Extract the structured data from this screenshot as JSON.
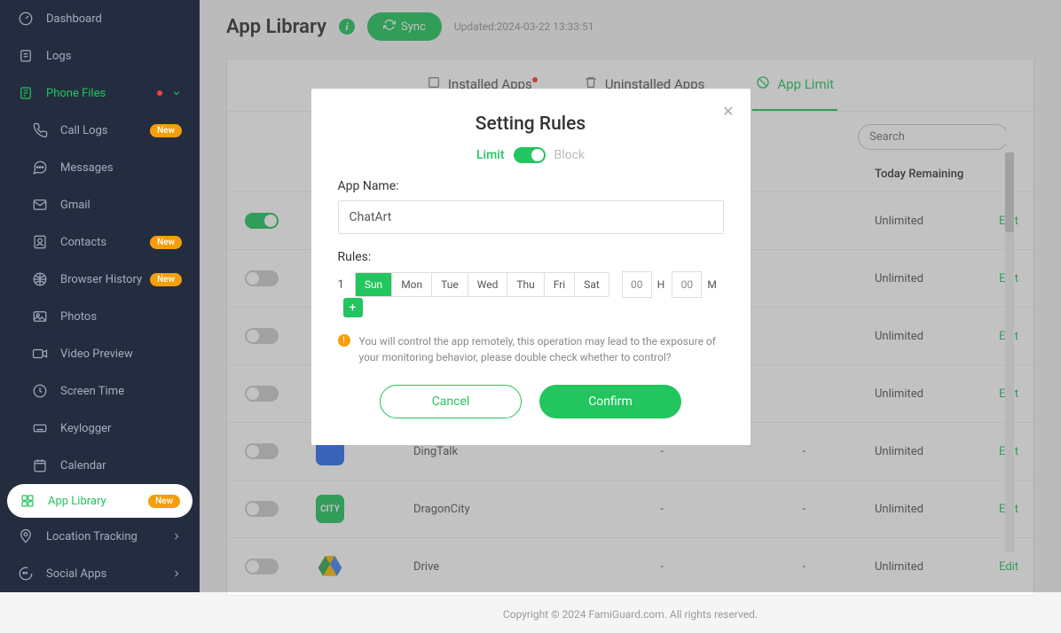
{
  "sidebar": {
    "items": [
      {
        "label": "Dashboard",
        "icon": "dashboard-icon"
      },
      {
        "label": "Logs",
        "icon": "logs-icon"
      },
      {
        "label": "Phone Files",
        "icon": "phone-files-icon",
        "active_green": true,
        "has_dot": true,
        "has_chevron": true
      },
      {
        "label": "Call Logs",
        "icon": "call-icon",
        "badge": "New",
        "sub": true
      },
      {
        "label": "Messages",
        "icon": "messages-icon",
        "sub": true
      },
      {
        "label": "Gmail",
        "icon": "gmail-icon",
        "sub": true
      },
      {
        "label": "Contacts",
        "icon": "contacts-icon",
        "badge": "New",
        "sub": true
      },
      {
        "label": "Browser History",
        "icon": "browser-icon",
        "badge": "New",
        "sub": true
      },
      {
        "label": "Photos",
        "icon": "photos-icon",
        "sub": true
      },
      {
        "label": "Video Preview",
        "icon": "video-icon",
        "sub": true
      },
      {
        "label": "Screen Time",
        "icon": "screentime-icon",
        "sub": true
      },
      {
        "label": "Keylogger",
        "icon": "keylogger-icon",
        "sub": true
      },
      {
        "label": "Calendar",
        "icon": "calendar-icon",
        "sub": true
      },
      {
        "label": "App Library",
        "icon": "applib-icon",
        "badge": "New",
        "sub": true,
        "app_active": true
      },
      {
        "label": "Location Tracking",
        "icon": "location-icon",
        "has_chevron_right": true
      },
      {
        "label": "Social Apps",
        "icon": "social-icon",
        "has_chevron_right": true
      }
    ]
  },
  "header": {
    "title": "App Library",
    "sync": "Sync",
    "updated": "Updated:2024-03-22 13:33:51"
  },
  "tabs": {
    "installed": "Installed Apps",
    "uninstalled": "Uninstalled Apps",
    "limit": "App Limit"
  },
  "search": {
    "placeholder": "Search"
  },
  "table": {
    "headers": {
      "today_remaining": "Today Remaining"
    },
    "rows": [
      {
        "toggle": true,
        "name": "",
        "c1": "",
        "c2": "",
        "remaining": "Unlimited",
        "action": "Edit",
        "icon_bg": "#22c55e"
      },
      {
        "toggle": false,
        "name": "",
        "c1": "",
        "c2": "",
        "remaining": "Unlimited",
        "action": "Edit",
        "icon_bg": "#3b82f6"
      },
      {
        "toggle": false,
        "name": "",
        "c1": "",
        "c2": "",
        "remaining": "Unlimited",
        "action": "Edit",
        "icon_bg": "#3b82f6"
      },
      {
        "toggle": false,
        "name": "",
        "c1": "",
        "c2": "",
        "remaining": "Unlimited",
        "action": "Edit",
        "icon_bg": "#3b82f6"
      },
      {
        "toggle": false,
        "name": "DingTalk",
        "c1": "-",
        "c2": "-",
        "remaining": "Unlimited",
        "action": "Edit",
        "icon_bg": "#2e6ff0"
      },
      {
        "toggle": false,
        "name": "DragonCity",
        "c1": "-",
        "c2": "-",
        "remaining": "Unlimited",
        "action": "Edit",
        "icon_bg": "#22c55e",
        "icon_text": "CITY"
      },
      {
        "toggle": false,
        "name": "Drive",
        "c1": "-",
        "c2": "-",
        "remaining": "Unlimited",
        "action": "Edit",
        "icon_bg": "#fff",
        "is_drive": true
      }
    ]
  },
  "footer": "Copyright © 2024 FamiGuard.com. All rights reserved.",
  "modal": {
    "title": "Setting Rules",
    "limit_label": "Limit",
    "block_label": "Block",
    "app_name_label": "App Name:",
    "app_name_value": "ChatArt",
    "rules_label": "Rules:",
    "rule_number": "1",
    "days": [
      "Sun",
      "Mon",
      "Tue",
      "Wed",
      "Thu",
      "Fri",
      "Sat"
    ],
    "active_day_index": 0,
    "hour_value": "00",
    "hour_label": "H",
    "minute_value": "00",
    "minute_label": "M",
    "warning": "You will control the app remotely, this operation may lead to the exposure of your monitoring behavior, please double check whether to control?",
    "cancel": "Cancel",
    "confirm": "Confirm"
  }
}
